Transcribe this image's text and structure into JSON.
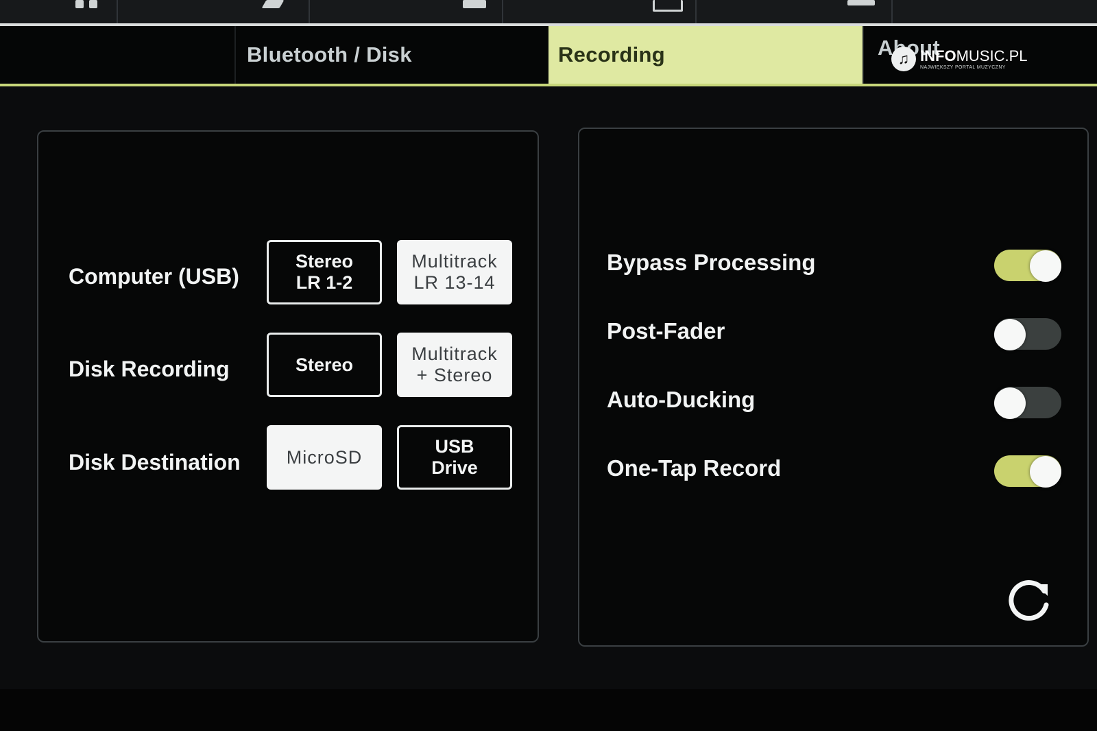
{
  "tabs": [
    {
      "label": "Bluetooth / Disk",
      "active": false
    },
    {
      "label": "Recording",
      "active": true
    },
    {
      "label": "About",
      "active": false
    }
  ],
  "watermark": {
    "brand_bold": "INFO",
    "brand_rest": "MUSIC.PL",
    "tagline": "NAJWIĘKSZY PORTAL MUZYCZNY"
  },
  "recording_options": [
    {
      "label": "Computer (USB)",
      "options": [
        {
          "lines": [
            "Stereo",
            "LR 1-2"
          ],
          "selected": false
        },
        {
          "lines": [
            "Multitrack",
            "LR 13-14"
          ],
          "selected": true
        }
      ]
    },
    {
      "label": "Disk Recording",
      "options": [
        {
          "lines": [
            "Stereo"
          ],
          "selected": false
        },
        {
          "lines": [
            "Multitrack",
            "+ Stereo"
          ],
          "selected": true
        }
      ]
    },
    {
      "label": "Disk Destination",
      "options": [
        {
          "lines": [
            "MicroSD"
          ],
          "selected": true
        },
        {
          "lines": [
            "USB",
            "Drive"
          ],
          "selected": false
        }
      ]
    }
  ],
  "toggles": [
    {
      "label": "Bypass Processing",
      "on": true
    },
    {
      "label": "Post-Fader",
      "on": false
    },
    {
      "label": "Auto-Ducking",
      "on": false
    },
    {
      "label": "One-Tap Record",
      "on": true
    }
  ],
  "colors": {
    "accent": "#dfe9a2",
    "toggle_on": "#c9d26e",
    "toggle_off": "#3b403f"
  },
  "icons": {
    "reset": "refresh-icon"
  }
}
